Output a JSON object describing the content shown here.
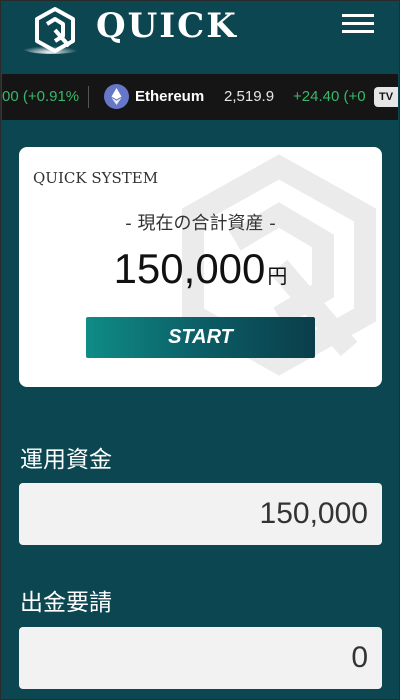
{
  "header": {
    "logo_text": "QUICK"
  },
  "ticker": {
    "prev_change": "00 (+0.91%",
    "item_name": "Ethereum",
    "item_icon": "ethereum-icon",
    "item_price": "2,519.9",
    "item_change": "+24.40 (+0",
    "badge": "TV",
    "up_color": "#3ab76a"
  },
  "card": {
    "brand": "QUICK SYSTEM",
    "subtitle": "- 現在の合計資産 -",
    "amount": "150,000",
    "unit": "円",
    "start_label": "START"
  },
  "operating_funds": {
    "label": "運用資金",
    "value": "150,000"
  },
  "withdrawal_request": {
    "label": "出金要請",
    "value": "0"
  },
  "colors": {
    "background": "#0b4651",
    "accent": "#0f8c86"
  }
}
